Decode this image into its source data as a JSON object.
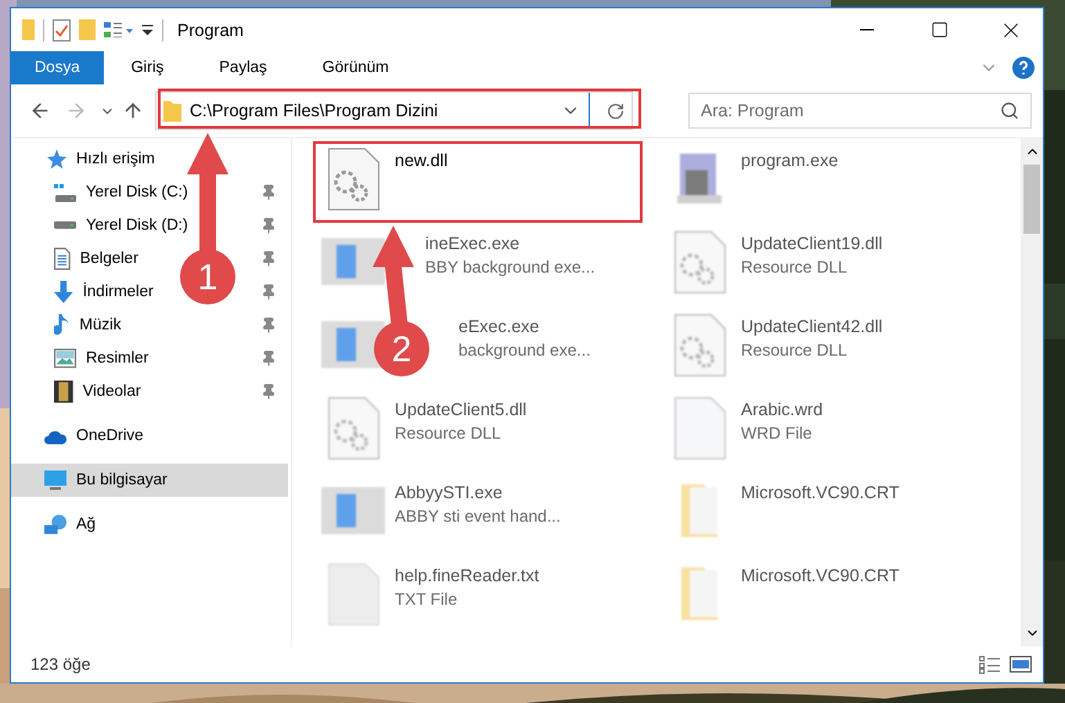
{
  "window": {
    "title": "Program"
  },
  "ribbon_tabs": [
    {
      "label": "Dosya",
      "kind": "file"
    },
    {
      "label": "Giriş",
      "kind": "tab"
    },
    {
      "label": "Paylaş",
      "kind": "tab"
    },
    {
      "label": "Görünüm",
      "kind": "tab"
    }
  ],
  "address_bar": {
    "path": "C:\\Program Files\\Program Dizini"
  },
  "search": {
    "placeholder": "Ara: Program"
  },
  "sidebar": [
    {
      "label": "Hızlı erişim",
      "kind": "star",
      "selected": false,
      "children": [
        {
          "label": "Yerel Disk (C:)",
          "kind": "systemdrive",
          "pinned": true
        },
        {
          "label": "Yerel Disk (D:)",
          "kind": "drive",
          "pinned": true
        },
        {
          "label": "Belgeler",
          "kind": "document",
          "pinned": true
        },
        {
          "label": "İndirmeler",
          "kind": "download",
          "pinned": true
        },
        {
          "label": "Müzik",
          "kind": "music",
          "pinned": true
        },
        {
          "label": "Resimler",
          "kind": "pictures",
          "pinned": true
        },
        {
          "label": "Videolar",
          "kind": "video",
          "pinned": true
        }
      ]
    },
    {
      "label": "OneDrive",
      "kind": "cloud",
      "selected": false
    },
    {
      "label": "Bu bilgisayar",
      "kind": "computer",
      "selected": true
    },
    {
      "label": "Ağ",
      "kind": "network",
      "selected": false
    }
  ],
  "files": [
    {
      "name": "new.dll",
      "kind": "library",
      "blurred": false
    },
    {
      "name": "program.exe",
      "kind": "installer",
      "blurred": true
    },
    {
      "name": "ineExec.exe",
      "type": "BBY background exe...",
      "kind": "application",
      "blurred": true
    },
    {
      "name": "UpdateClient19.dll",
      "type": "Resource DLL",
      "kind": "library",
      "blurred": true
    },
    {
      "name": "eExec.exe",
      "type": "background exe...",
      "kind": "application",
      "blurred": true
    },
    {
      "name": "UpdateClient42.dll",
      "type": "Resource DLL",
      "kind": "library",
      "blurred": true
    },
    {
      "name": "UpdateClient5.dll",
      "type": "Resource DLL",
      "kind": "library",
      "blurred": true
    },
    {
      "name": "Arabic.wrd",
      "type": "WRD File",
      "kind": "blank",
      "blurred": true
    },
    {
      "name": "AbbyySTI.exe",
      "type": "ABBY sti event hand...",
      "kind": "application",
      "blurred": true
    },
    {
      "name": "Microsoft.VC90.CRT",
      "kind": "folder",
      "blurred": true
    },
    {
      "name": "help.fineReader.txt",
      "type": "TXT File",
      "kind": "text",
      "blurred": true
    },
    {
      "name": "Microsoft.VC90.CRT",
      "kind": "folder",
      "blurred": true
    }
  ],
  "status_bar": {
    "count": "123 öğe"
  },
  "annotations": [
    {
      "number": "1"
    },
    {
      "number": "2"
    }
  ]
}
